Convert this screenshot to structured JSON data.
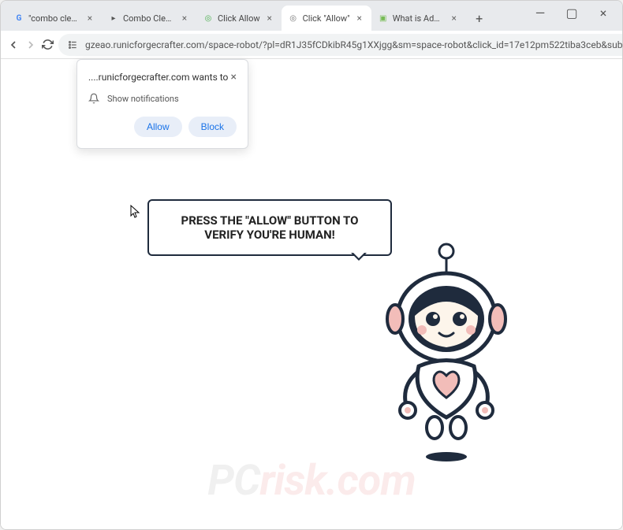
{
  "tabs": [
    {
      "title": "\"combo cleaner\" - ",
      "favicon": "G",
      "favcolor": "#4285f4"
    },
    {
      "title": "Combo Cleaner Pr",
      "favicon": "▸",
      "favcolor": "#555"
    },
    {
      "title": "Click Allow",
      "favicon": "◎",
      "favcolor": "#4caf50"
    },
    {
      "title": "Click \"Allow\"",
      "favicon": "◎",
      "favcolor": "#777",
      "active": true
    },
    {
      "title": "What is Adware Vi",
      "favicon": "▣",
      "favcolor": "#7b5"
    }
  ],
  "address_bar": {
    "url": "gzeao.runicforgecrafter.com/space-robot/?pl=dR1J35fCDkibR45g1XXjgg&sm=space-robot&click_id=17e12pm522tiba3ceb&sub..."
  },
  "permission_popup": {
    "domain": "....runicforgecrafter.com wants to",
    "permission_text": "Show notifications",
    "allow_label": "Allow",
    "block_label": "Block"
  },
  "speech": {
    "text": "PRESS THE \"ALLOW\" BUTTON TO VERIFY YOU'RE HUMAN!"
  },
  "watermark": {
    "p": "P",
    "c": "C",
    "rest": "risk.com"
  },
  "colors": {
    "robot_dark": "#1f2b3d",
    "robot_pink": "#f2bdb9",
    "robot_screen": "#fdf5eb"
  }
}
